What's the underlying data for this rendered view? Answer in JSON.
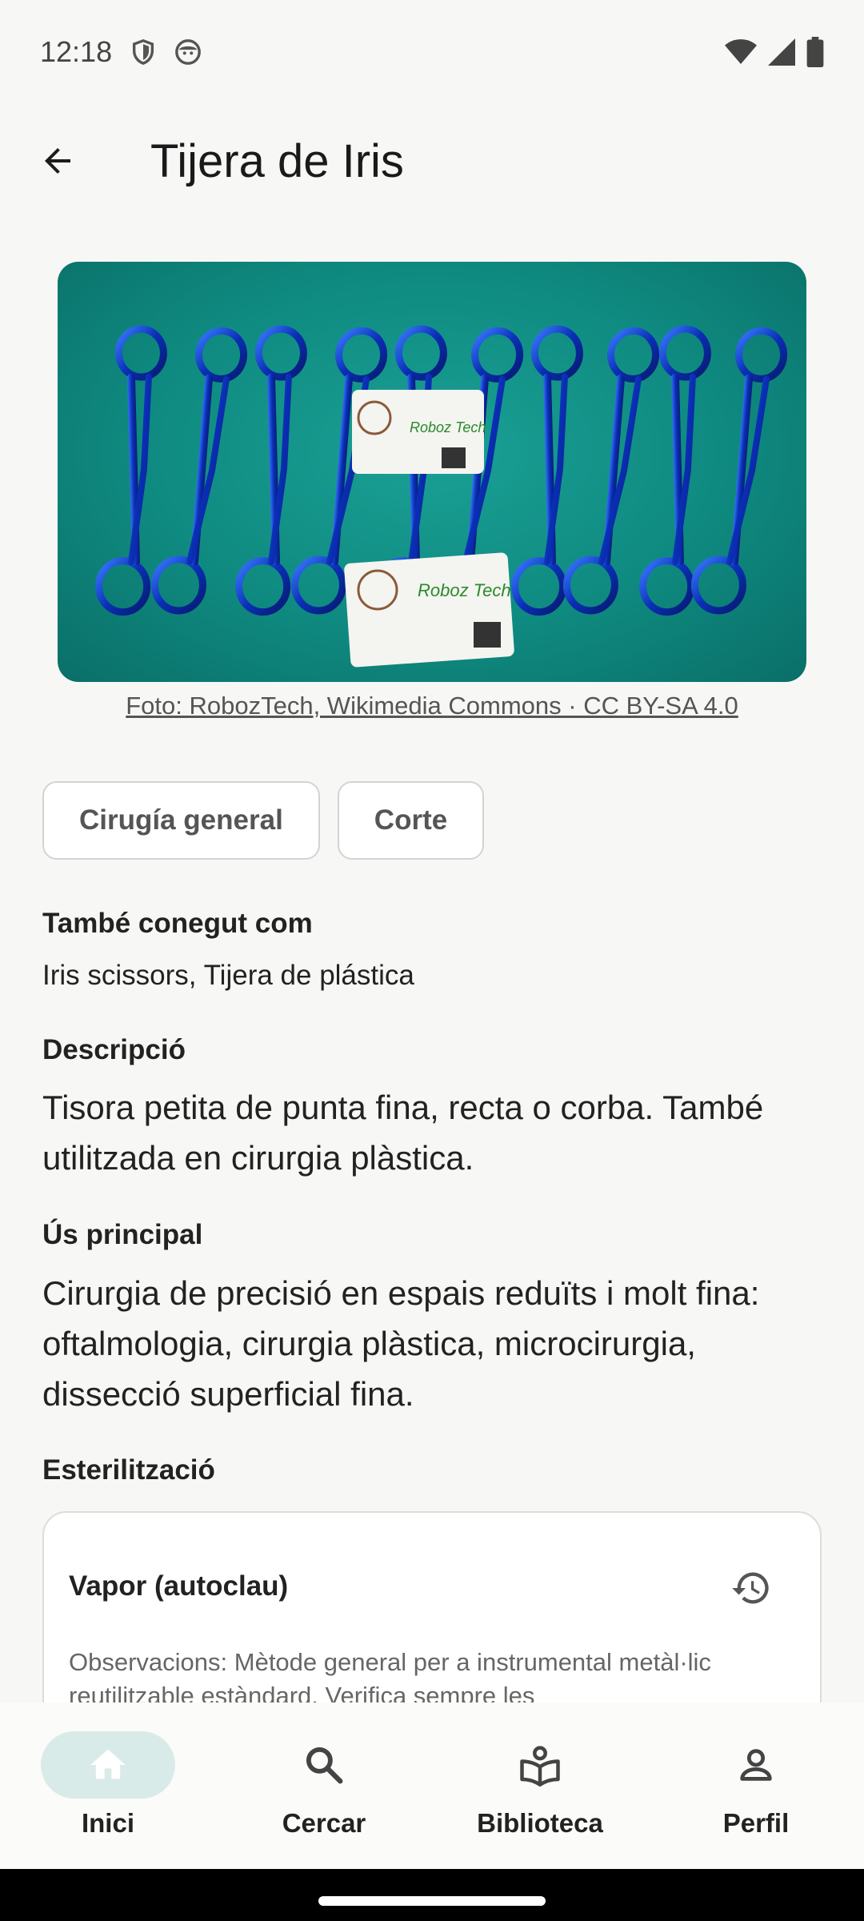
{
  "status_bar": {
    "time": "12:18"
  },
  "header": {
    "title": "Tijera de Iris"
  },
  "image": {
    "credit": "Foto: RobozTech, Wikimedia Commons · CC BY-SA 4.0",
    "card_text": "Roboz Tech"
  },
  "chips": [
    "Cirugía general",
    "Corte"
  ],
  "aka": {
    "label": "També conegut com",
    "value": "Iris scissors, Tijera de plástica"
  },
  "description": {
    "label": "Descripció",
    "value": "Tisora petita de punta fina, recta o corba. També utilitzada en cirurgia plàstica."
  },
  "main_use": {
    "label": "Ús principal",
    "value": "Cirurgia de precisió en espais reduïts i molt fina: oftalmologia, cirurgia plàstica, microcirurgia, dissecció superficial fina."
  },
  "sterilization": {
    "label": "Esterilització",
    "method": "Vapor (autoclau)",
    "notes": "Observacions: Mètode general per a instrumental metàl·lic reutilitzable estàndard. Verifica sempre les"
  },
  "nav": [
    {
      "label": "Inici",
      "icon": "home-icon",
      "active": true
    },
    {
      "label": "Cercar",
      "icon": "search-icon",
      "active": false
    },
    {
      "label": "Biblioteca",
      "icon": "library-icon",
      "active": false
    },
    {
      "label": "Perfil",
      "icon": "person-icon",
      "active": false
    }
  ],
  "colors": {
    "accent": "#d9ebe8",
    "surface": "#f7f7f5",
    "photo_bg": "#0f8a80"
  }
}
